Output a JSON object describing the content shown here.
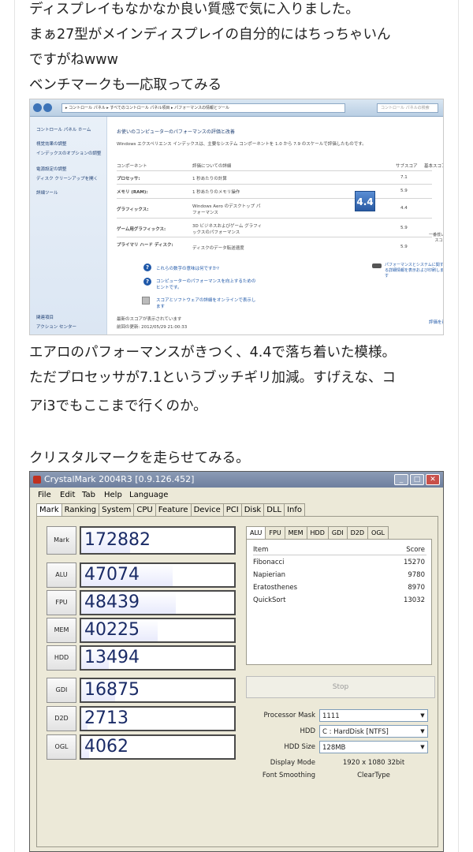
{
  "paragraphs": {
    "p1": "ディスプレイもなかなか良い質感で気に入りました。",
    "p2": "まぁ27型がメインディスプレイの自分的にはちっちゃいん",
    "p3": "ですがねwww",
    "p4": "ベンチマークも一応取ってみる",
    "p5": "エアロのパフォーマンスがきつく、4.4で落ち着いた模様。",
    "p6": "ただプロセッサが7.1というブッチギリ加減。すげえな、コ",
    "p7": "アi3でもここまで行くのか。",
    "p8": "クリスタルマークを走らせてみる。"
  },
  "perf": {
    "breadcrumb": "▸ コントロール パネル ▸ すべてのコントロール パネル項目 ▸ パフォーマンスの情報とツール",
    "search": "コントロール パネルの検索",
    "side": [
      "コントロール パネル ホーム",
      "視覚効果の調整",
      "インデックスのオプションの調整",
      "電源設定の調整",
      "ディスク クリーンアップを開く",
      "詳細ツール",
      "関連項目",
      "アクション センター"
    ],
    "heading": "お使いのコンピューターのパフォーマンスの評価と改善",
    "desc": "Windows エクスペリエンス インデックスは、主要なシステム コンポーネントを 1.0 から 7.9 のスケールで評価したものです。",
    "col_component": "コンポーネント",
    "col_detail": "評価についての詳細",
    "col_sub": "サブスコア",
    "col_base": "基本スコア",
    "rows": [
      {
        "name": "プロセッサ:",
        "detail": "1 秒あたりの計算",
        "score": "7.1"
      },
      {
        "name": "メモリ (RAM):",
        "detail": "1 秒あたりのメモリ操作",
        "score": "5.9"
      },
      {
        "name": "グラフィックス:",
        "detail": "Windows Aero のデスクトップ パフォーマンス",
        "score": "4.4"
      },
      {
        "name": "ゲーム用グラフィックス:",
        "detail": "3D ビジネスおよびゲーム グラフィックスのパフォーマンス",
        "score": "5.9"
      },
      {
        "name": "プライマリ ハード ディスク:",
        "detail": "ディスクのデータ転送速度",
        "score": "5.9"
      }
    ],
    "base_score": "4.4",
    "base_caption": "一番低いサブスコア",
    "link1": "これらの数字の意味は何ですか?",
    "link2": "コンピューターのパフォーマンスを向上するためのヒントです。",
    "link3": "スコアとソフトウェアの詳細をオンラインで表示します",
    "right_link": "パフォーマンスとシステムに関する詳細情報を表示および印刷します",
    "footer1": "最新のスコアが表示されています",
    "footer2": "前回の更新: 2012/05/29 21:00:33",
    "rerun": "評価を再実行"
  },
  "crystalmark": {
    "title": "CrystalMark 2004R3 [0.9.126.452]",
    "menu": [
      "File",
      "Edit",
      "Tab",
      "Help",
      "Language"
    ],
    "tabs": [
      "Mark",
      "Ranking",
      "System",
      "CPU",
      "Feature",
      "Device",
      "PCI",
      "Disk",
      "DLL",
      "Info"
    ],
    "scores": [
      {
        "label": "Mark",
        "value": "172882",
        "fill": 0.32
      },
      {
        "label": "ALU",
        "value": "47074",
        "fill": 0.6
      },
      {
        "label": "FPU",
        "value": "48439",
        "fill": 0.62
      },
      {
        "label": "MEM",
        "value": "40225",
        "fill": 0.5
      },
      {
        "label": "HDD",
        "value": "13494",
        "fill": 0.18
      },
      {
        "label": "GDI",
        "value": "16875",
        "fill": 0.22
      },
      {
        "label": "D2D",
        "value": "2713",
        "fill": 0.04
      },
      {
        "label": "OGL",
        "value": "4062",
        "fill": 0.05
      }
    ],
    "rtabs": [
      "ALU",
      "FPU",
      "MEM",
      "HDD",
      "GDI",
      "D2D",
      "OGL"
    ],
    "table_head": {
      "item": "Item",
      "score": "Score"
    },
    "table_rows": [
      {
        "item": "Fibonacci",
        "score": "15270"
      },
      {
        "item": "Napierian",
        "score": "9780"
      },
      {
        "item": "Eratosthenes",
        "score": "8970"
      },
      {
        "item": "QuickSort",
        "score": "13032"
      }
    ],
    "stop": "Stop",
    "processor_mask_label": "Processor Mask",
    "processor_mask": "1111",
    "hdd_label": "HDD",
    "hdd": "C : HardDisk [NTFS]",
    "hdd_size_label": "HDD Size",
    "hdd_size": "128MB",
    "display_mode_label": "Display Mode",
    "display_mode": "1920 x 1080 32bit",
    "font_smoothing_label": "Font Smoothing",
    "font_smoothing": "ClearType"
  }
}
